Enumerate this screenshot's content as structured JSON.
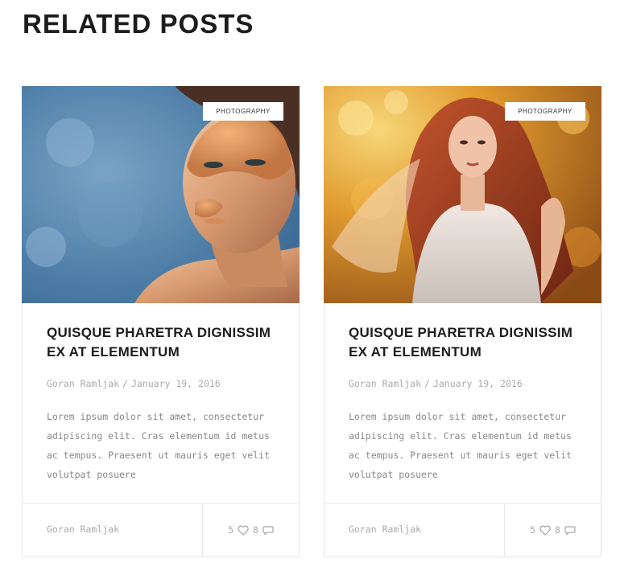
{
  "section": {
    "title": "RELATED POSTS"
  },
  "posts": [
    {
      "category": "PHOTOGRAPHY",
      "title": "QUISQUE PHARETRA DIGNISSIM EX AT ELEMENTUM",
      "author": "Goran Ramljak",
      "separator": "/",
      "date": "January 19, 2016",
      "excerpt": "Lorem ipsum dolor sit amet, consectetur adipiscing elit. Cras elementum id metus ac tempus. Praesent ut mauris eget velit volutpat posuere",
      "footer_author": "Goran Ramljak",
      "likes": "5",
      "comments": "8",
      "like_icon": "heart-icon",
      "comment_icon": "comment-icon"
    },
    {
      "category": "PHOTOGRAPHY",
      "title": "QUISQUE PHARETRA DIGNISSIM EX AT ELEMENTUM",
      "author": "Goran Ramljak",
      "separator": "/",
      "date": "January 19, 2016",
      "excerpt": "Lorem ipsum dolor sit amet, consectetur adipiscing elit. Cras elementum id metus ac tempus. Praesent ut mauris eget velit volutpat posuere",
      "footer_author": "Goran Ramljak",
      "likes": "5",
      "comments": "8",
      "like_icon": "heart-icon",
      "comment_icon": "comment-icon"
    }
  ],
  "colors": {
    "title": "#1c1c1c",
    "meta": "#aaaaaa",
    "excerpt": "#888888",
    "border": "#e6e6e6"
  }
}
